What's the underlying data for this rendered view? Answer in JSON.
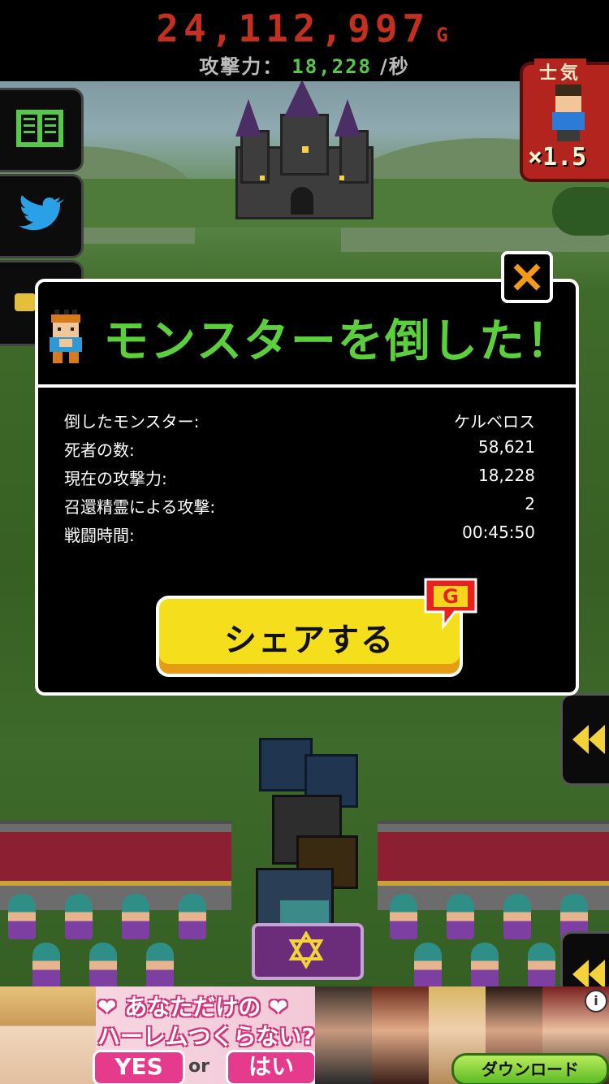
{
  "hud": {
    "gold_value": "24,112,997",
    "gold_unit": "G",
    "attack_label": "攻撃力：",
    "attack_value": "18,228",
    "attack_unit": "/秒"
  },
  "morale": {
    "label": "士気",
    "multiplier": "×1.5"
  },
  "dialog": {
    "title": "モンスターを倒した！",
    "rows": [
      {
        "label": "倒したモンスター:",
        "value": "ケルベロス"
      },
      {
        "label": "死者の数:",
        "value": "58,621"
      },
      {
        "label": "現在の攻撃力:",
        "value": "18,228"
      },
      {
        "label": "召還精霊による攻撃:",
        "value": "2"
      },
      {
        "label": "戦闘時間:",
        "value": "00:45:50"
      }
    ],
    "share_label": "シェアする",
    "badge_letter": "G"
  },
  "ad": {
    "line1": "❤ あなただけの ❤",
    "line2": "ハーレムつくらない?",
    "yes_label": "YES",
    "or_label": "or",
    "hai_label": "はい",
    "download_label": "ダウンロード",
    "info_label": "i"
  },
  "colors": {
    "gold": "#c4301f",
    "accent_green": "#5ccf3c",
    "share_yellow": "#f5df1c",
    "morale_red": "#b3241e",
    "ad_pink": "#e63a8d"
  }
}
